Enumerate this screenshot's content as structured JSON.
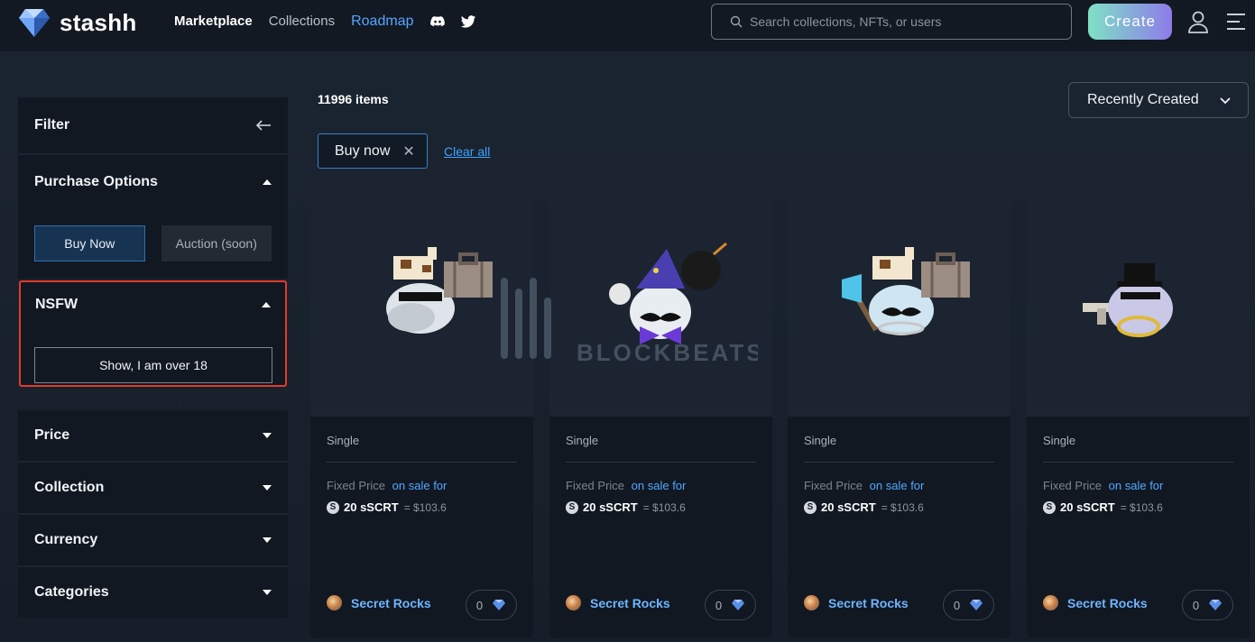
{
  "header": {
    "logo_text": "stashh",
    "nav": [
      {
        "label": "Marketplace"
      },
      {
        "label": "Collections"
      },
      {
        "label": "Roadmap"
      }
    ],
    "search_placeholder": "Search collections, NFTs, or users",
    "create_label": "Create"
  },
  "sidebar": {
    "filter_label": "Filter",
    "purchase_options_label": "Purchase Options",
    "buy_now_label": "Buy Now",
    "auction_label": "Auction (soon)",
    "nsfw_label": "NSFW",
    "show_nsfw_label": "Show, I am over 18",
    "sections": [
      {
        "label": "Price"
      },
      {
        "label": "Collection"
      },
      {
        "label": "Currency"
      },
      {
        "label": "Categories"
      }
    ]
  },
  "main": {
    "items_count": "11996 items",
    "sort_label": "Recently Created",
    "active_filter": "Buy now",
    "clear_all": "Clear all",
    "cards": [
      {
        "edition": "Single",
        "price_type": "Fixed Price",
        "sale_text": "on sale for",
        "amount": "20 sSCRT",
        "usd": "= $103.6",
        "collection": "Secret Rocks",
        "likes": "0"
      },
      {
        "edition": "Single",
        "price_type": "Fixed Price",
        "sale_text": "on sale for",
        "amount": "20 sSCRT",
        "usd": "= $103.6",
        "collection": "Secret Rocks",
        "likes": "0"
      },
      {
        "edition": "Single",
        "price_type": "Fixed Price",
        "sale_text": "on sale for",
        "amount": "20 sSCRT",
        "usd": "= $103.6",
        "collection": "Secret Rocks",
        "likes": "0"
      },
      {
        "edition": "Single",
        "price_type": "Fixed Price",
        "sale_text": "on sale for",
        "amount": "20 sSCRT",
        "usd": "= $103.6",
        "collection": "Secret Rocks",
        "likes": "0"
      }
    ]
  },
  "watermark_text": "BLOCKBEATS",
  "colors": {
    "background": "#1b2531",
    "panel": "#111822",
    "accent_blue": "#3fa2ff",
    "highlight_red": "#e23b2b",
    "create_gradient_start": "#7fe1c6",
    "create_gradient_end": "#8e7be8"
  },
  "icons": [
    "diamond-logo-icon",
    "discord-icon",
    "twitter-icon",
    "search-icon",
    "user-icon",
    "menu-icon",
    "arrow-left-icon",
    "caret-up-icon",
    "caret-down-icon",
    "close-icon",
    "chevron-down-icon",
    "scrt-coin-icon",
    "diamond-like-icon"
  ]
}
